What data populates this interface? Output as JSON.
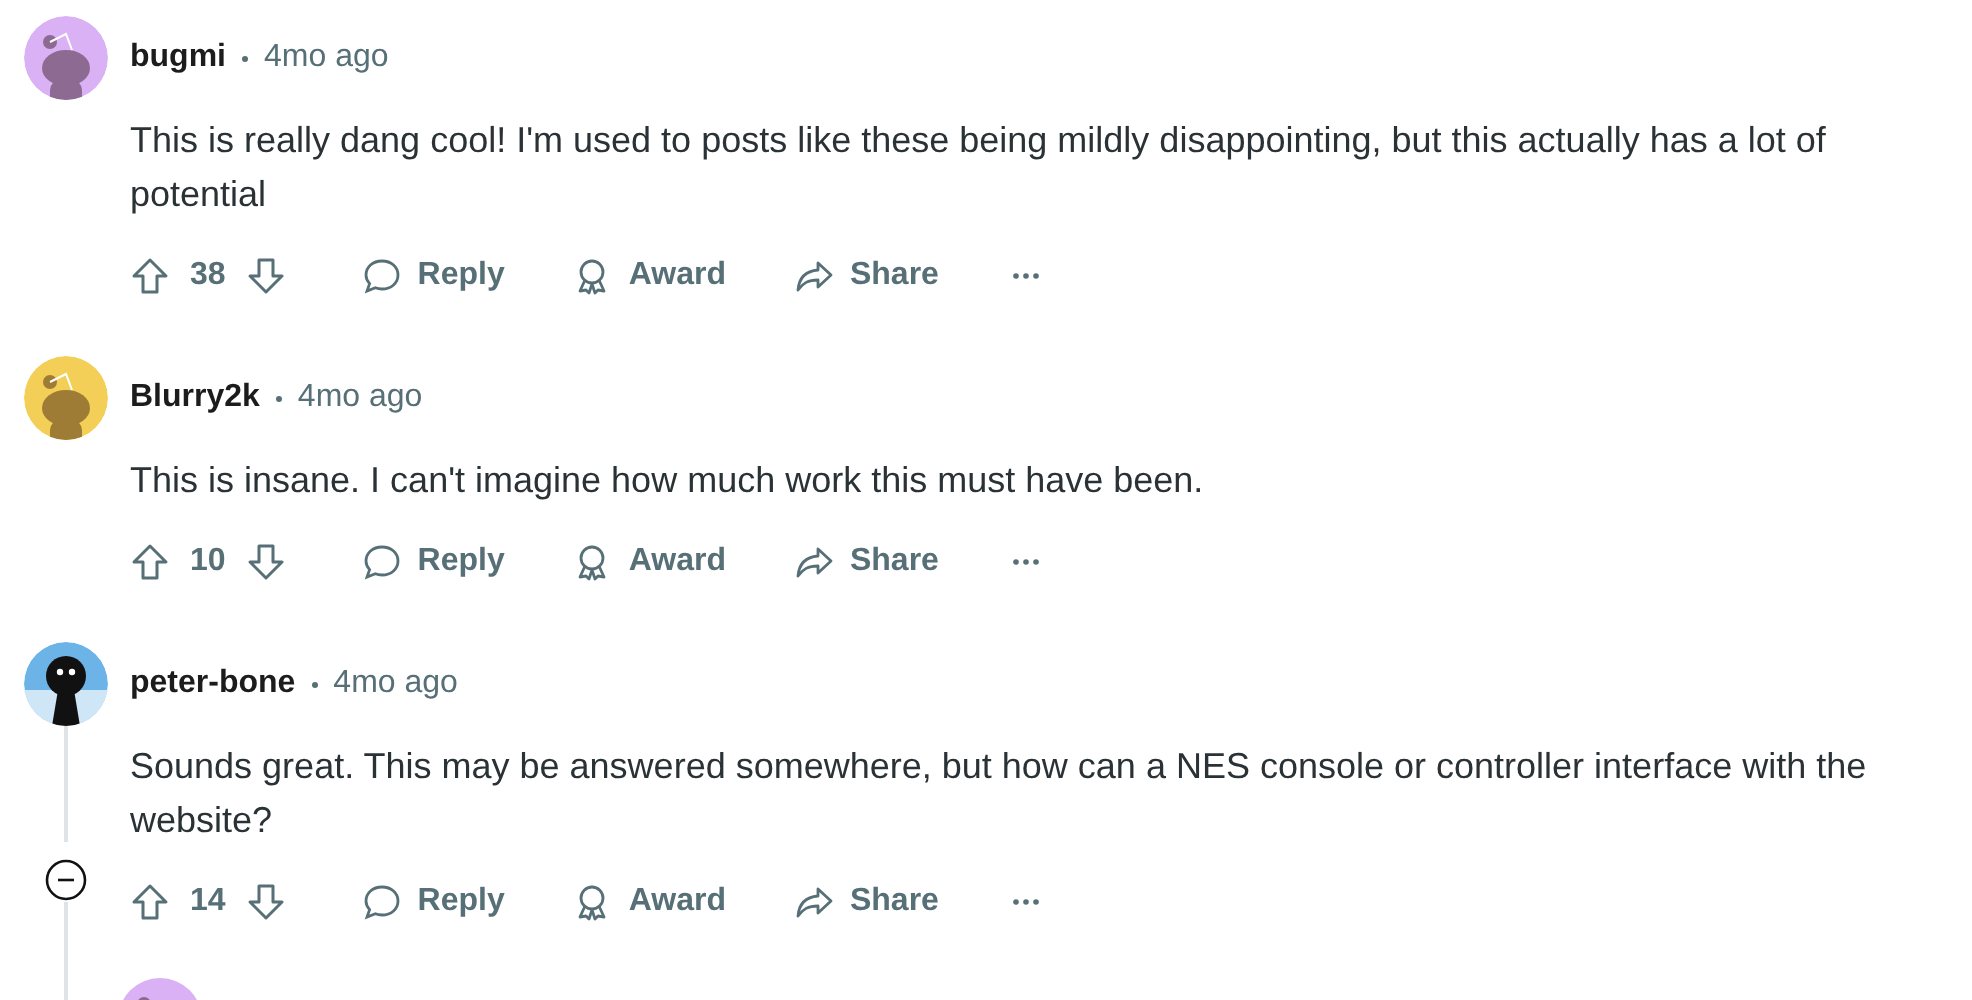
{
  "comments": [
    {
      "author": "bugmi",
      "time": "4mo ago",
      "avatar": {
        "kind": "snoo",
        "color": "#d9b1f4"
      },
      "body": "This is really dang cool! I'm used to posts like these being mildly disappointing, but this actually has a lot of potential",
      "score": "38",
      "actions": [
        "Reply",
        "Award",
        "Share"
      ],
      "thread_open": false
    },
    {
      "author": "Blurry2k",
      "time": "4mo ago",
      "avatar": {
        "kind": "snoo",
        "color": "#f3cf58"
      },
      "body": "This is insane. I can't imagine how much work this must have been.",
      "score": "10",
      "actions": [
        "Reply",
        "Award",
        "Share"
      ],
      "thread_open": false
    },
    {
      "author": "peter-bone",
      "time": "4mo ago",
      "avatar": {
        "kind": "figure",
        "color": "#6cb3e8"
      },
      "body": "Sounds great. This may be answered somewhere, but how can a NES console or controller interface with the website?",
      "score": "14",
      "actions": [
        "Reply",
        "Award",
        "Share"
      ],
      "thread_open": true,
      "replies": [
        {
          "avatar": {
            "kind": "snoo",
            "color": "#d9b1f4"
          }
        }
      ]
    }
  ]
}
